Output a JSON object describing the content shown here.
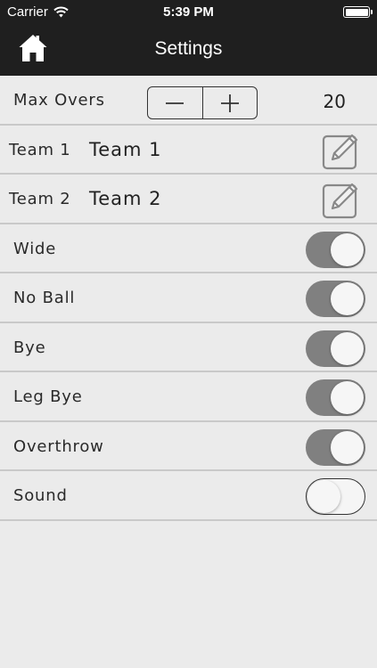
{
  "status_bar": {
    "carrier": "Carrier",
    "time": "5:39 PM",
    "wifi_icon": "wifi-icon",
    "battery_icon": "battery-icon"
  },
  "navbar": {
    "title": "Settings",
    "home_icon": "home-icon"
  },
  "max_overs": {
    "label": "Max Overs",
    "value": "20",
    "decrement_icon": "minus-icon",
    "increment_icon": "plus-icon"
  },
  "teams": [
    {
      "label": "Team 1",
      "value": "Team 1",
      "edit_icon": "edit-icon"
    },
    {
      "label": "Team 2",
      "value": "Team 2",
      "edit_icon": "edit-icon"
    }
  ],
  "toggles": [
    {
      "label": "Wide",
      "on": true
    },
    {
      "label": "No Ball",
      "on": true
    },
    {
      "label": "Bye",
      "on": true
    },
    {
      "label": "Leg Bye",
      "on": true
    },
    {
      "label": "Overthrow",
      "on": true
    },
    {
      "label": "Sound",
      "on": false
    }
  ],
  "colors": {
    "bar_background": "#1f1f1f",
    "page_background": "#ebebeb",
    "toggle_on": "#808080",
    "divider": "#c9c9c9"
  }
}
